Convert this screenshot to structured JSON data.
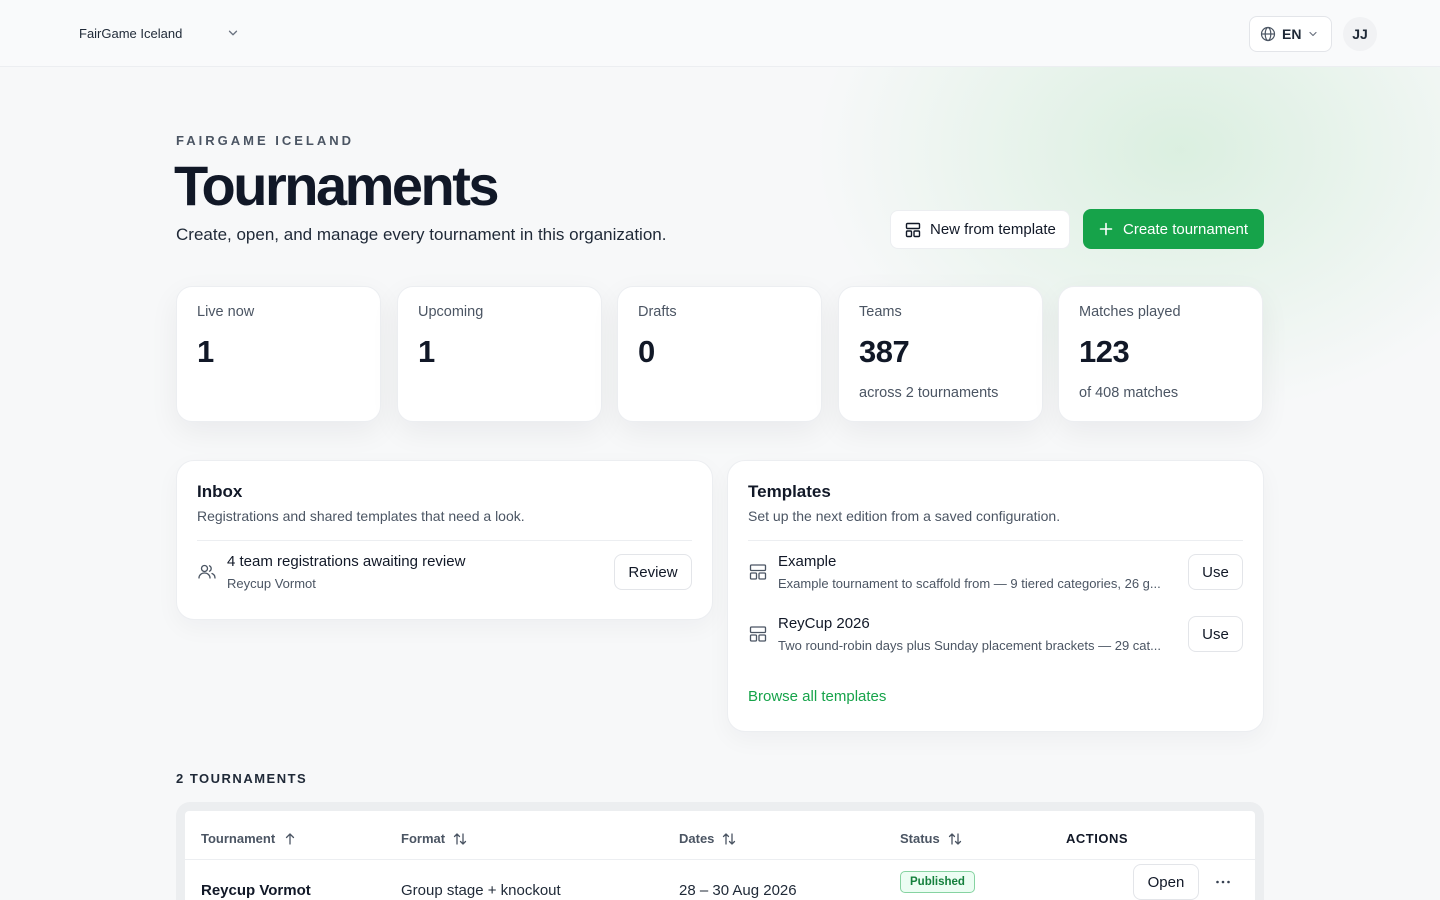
{
  "topbar": {
    "org_name": "FairGame Iceland",
    "language": "EN",
    "avatar_initials": "JJ"
  },
  "header": {
    "eyebrow": "FAIRGAME ICELAND",
    "title": "Tournaments",
    "subtitle": "Create, open, and manage every tournament in this organization.",
    "template_button": "New from template",
    "create_button": "Create tournament"
  },
  "stats": [
    {
      "label": "Live now",
      "value": "1",
      "note": ""
    },
    {
      "label": "Upcoming",
      "value": "1",
      "note": ""
    },
    {
      "label": "Drafts",
      "value": "0",
      "note": ""
    },
    {
      "label": "Teams",
      "value": "387",
      "note": "across 2 tournaments"
    },
    {
      "label": "Matches played",
      "value": "123",
      "note": "of 408 matches"
    }
  ],
  "inbox": {
    "title": "Inbox",
    "description": "Registrations and shared templates that need a look.",
    "items": [
      {
        "title": "4 team registrations awaiting review",
        "subtitle": "Reycup Vormot",
        "action": "Review"
      }
    ]
  },
  "templates": {
    "title": "Templates",
    "description": "Set up the next edition from a saved configuration.",
    "items": [
      {
        "title": "Example",
        "subtitle": "Example tournament to scaffold from — 9 tiered categories, 26 g...",
        "action": "Use"
      },
      {
        "title": "ReyCup 2026",
        "subtitle": "Two round-robin days plus Sunday placement brackets — 29 cat...",
        "action": "Use"
      }
    ],
    "browse_link": "Browse all templates"
  },
  "tournaments": {
    "count_label": "2 TOURNAMENTS",
    "columns": [
      "Tournament",
      "Format",
      "Dates",
      "Status",
      "ACTIONS"
    ],
    "rows": [
      {
        "name": "Reycup Vormot",
        "format": "Group stage + knockout",
        "dates": "28 – 30 Aug 2026",
        "status": "Published",
        "open_label": "Open"
      }
    ]
  },
  "colors": {
    "accent": "#16a34a",
    "badge_bg": "#ecfdf3",
    "badge_border": "#86d3a1"
  }
}
